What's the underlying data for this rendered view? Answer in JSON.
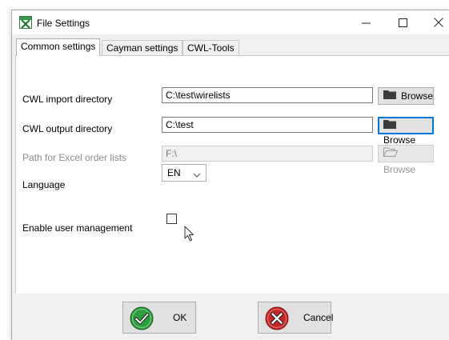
{
  "window": {
    "title": "File Settings",
    "icon": "excel-icon",
    "controls": {
      "minimize": "—",
      "maximize": "□",
      "close": "✕"
    }
  },
  "tabs": [
    {
      "label": "Common settings",
      "active": true
    },
    {
      "label": "Cayman settings",
      "active": false
    },
    {
      "label": "CWL-Tools",
      "active": false
    }
  ],
  "settings": {
    "import_dir": {
      "label": "CWL import directory",
      "value": "C:\\test\\wirelists",
      "browse_label": "Browse"
    },
    "output_dir": {
      "label": "CWL output directory",
      "value": "C:\\test",
      "browse_label": "Browse"
    },
    "excel_path": {
      "label": "Path for Excel order lists",
      "value": "F:\\",
      "browse_label": "Browse",
      "enabled": false
    },
    "language": {
      "label": "Language",
      "value": "EN"
    },
    "user_management": {
      "label": "Enable user management",
      "checked": false
    }
  },
  "footer": {
    "ok_label": "OK",
    "cancel_label": "Cancel"
  },
  "colors": {
    "focus_border": "#0078d7",
    "ok_icon": "#2e9d3f",
    "cancel_icon": "#c62828"
  }
}
